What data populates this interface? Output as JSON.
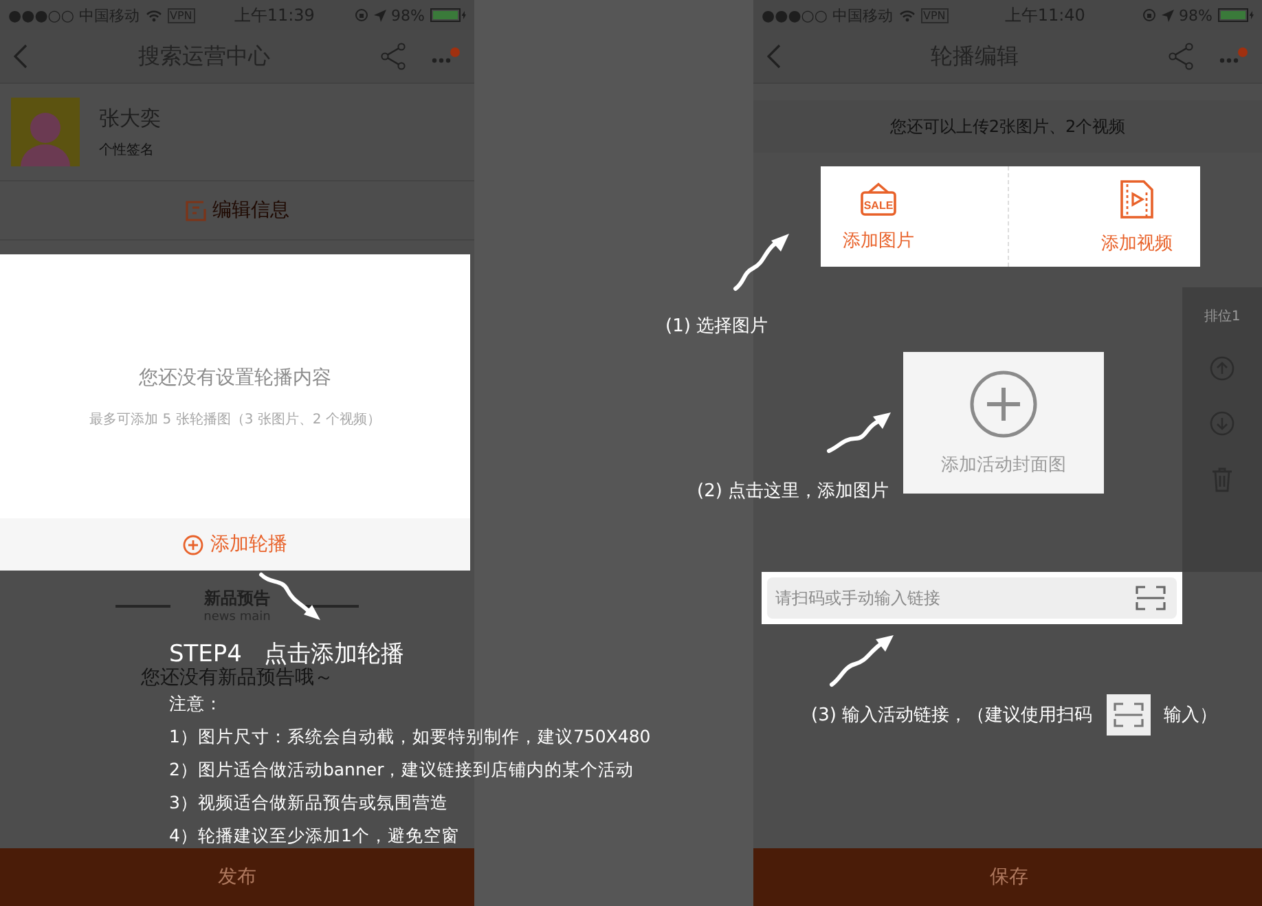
{
  "left_screen": {
    "status_bar": {
      "carrier": "●●●○○ 中国移动",
      "vpn": "VPN",
      "time": "上午11:39",
      "battery": "98%"
    },
    "nav": {
      "title": "搜索运营中心"
    },
    "profile": {
      "name": "张大奕",
      "signature": "个性签名"
    },
    "edit_button": "编辑信息",
    "dialog": {
      "message": "您还没有设置轮播内容",
      "hint": "最多可添加 5 张轮播图（3 张图片、2 个视频）",
      "add_button": "添加轮播"
    },
    "news_section": {
      "title": "新品预告",
      "subtitle": "news main",
      "empty_text": "您还没有新品预告哦～"
    },
    "publish_button": "发布"
  },
  "right_screen": {
    "status_bar": {
      "carrier": "●●●○○ 中国移动",
      "vpn": "VPN",
      "time": "上午11:40",
      "battery": "98%"
    },
    "nav": {
      "title": "轮播编辑"
    },
    "upload_hint": "您还可以上传2张图片、2个视频",
    "upload_options": [
      {
        "kind": "image",
        "label": "添加图片",
        "icon_text": "SALE"
      },
      {
        "kind": "video",
        "label": "添加视频"
      }
    ],
    "cover_card": {
      "label": "添加活动封面图"
    },
    "side_panel": {
      "rank": "排位1"
    },
    "link_field": {
      "placeholder": "请扫码或手动输入链接"
    },
    "save_button": "保存"
  },
  "annotations": {
    "step_title": "STEP4   点击添加轮播",
    "notes_title": "注意：",
    "notes": [
      "1）图片尺寸：系统会自动截，如要特别制作，建议750X480",
      "2）图片适合做活动banner，建议链接到店铺内的某个活动",
      "3）视频适合做新品预告或氛围营造",
      "4）轮播建议至少添加1个，避免空窗"
    ],
    "callouts": [
      {
        "kind": "plain",
        "text": "(1) 选择图片"
      },
      {
        "kind": "plain",
        "text": "(2) 点击这里，添加图片"
      },
      {
        "kind": "scan",
        "text": "(3) 输入活动链接，（建议使用扫码",
        "text_after": "输入）"
      }
    ]
  }
}
